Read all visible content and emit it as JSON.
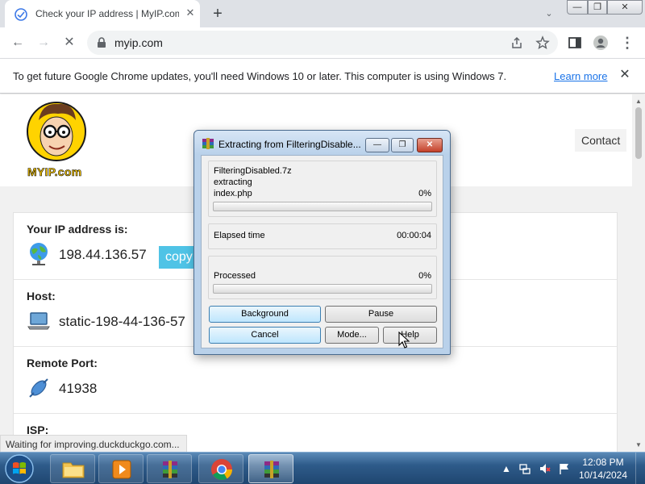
{
  "tab": {
    "title": "Check your IP address | MyIP.com",
    "close_glyph": "✕",
    "new_tab_glyph": "+",
    "search_glyph": "⌄"
  },
  "window_controls": {
    "minimize": "—",
    "maximize": "❐",
    "close": "✕"
  },
  "toolbar": {
    "url": "myip.com",
    "back_glyph": "←",
    "forward_glyph": "→",
    "stop_glyph": "✕",
    "menu_glyph": "⋮"
  },
  "infobar": {
    "message": "To get future Google Chrome updates, you'll need Windows 10 or later. This computer is using Windows 7.",
    "link": "Learn more",
    "close_glyph": "✕"
  },
  "site": {
    "logo_text": "MYIP.com",
    "contact": "Contact",
    "rows": [
      {
        "label": "Your IP address is:",
        "value": "198.44.136.57",
        "button": "copy",
        "icon": "globe-icon"
      },
      {
        "label": "Host:",
        "value": "static-198-44-136-57",
        "icon": "laptop-icon"
      },
      {
        "label": "Remote Port:",
        "value": "41938",
        "icon": "plug-icon"
      },
      {
        "label": "ISP:",
        "value": "",
        "icon": ""
      }
    ]
  },
  "status_bubble": "Waiting for improving.duckduckgo.com...",
  "dialog": {
    "title": "Extracting from FilteringDisable...",
    "archive": "FilteringDisabled.7z",
    "action": "extracting",
    "file": "index.php",
    "file_percent": "0%",
    "file_progress": 0,
    "elapsed_label": "Elapsed time",
    "elapsed_value": "00:00:04",
    "processed_label": "Processed",
    "processed_percent": "0%",
    "processed_progress": 0,
    "buttons": {
      "background": "Background",
      "pause": "Pause",
      "cancel": "Cancel",
      "mode": "Mode...",
      "help": "Help"
    }
  },
  "taskbar": {
    "time": "12:08 PM",
    "date": "10/14/2024",
    "apps": [
      "file-explorer-icon",
      "media-player-icon",
      "winrar-icon",
      "chrome-icon",
      "winrar-icon"
    ]
  },
  "colors": {
    "chrome_link": "#1a73e8",
    "copy_button": "#4fc3e6",
    "progress_green": "#06b025",
    "taskbar_blue": "#2e5b8a"
  }
}
